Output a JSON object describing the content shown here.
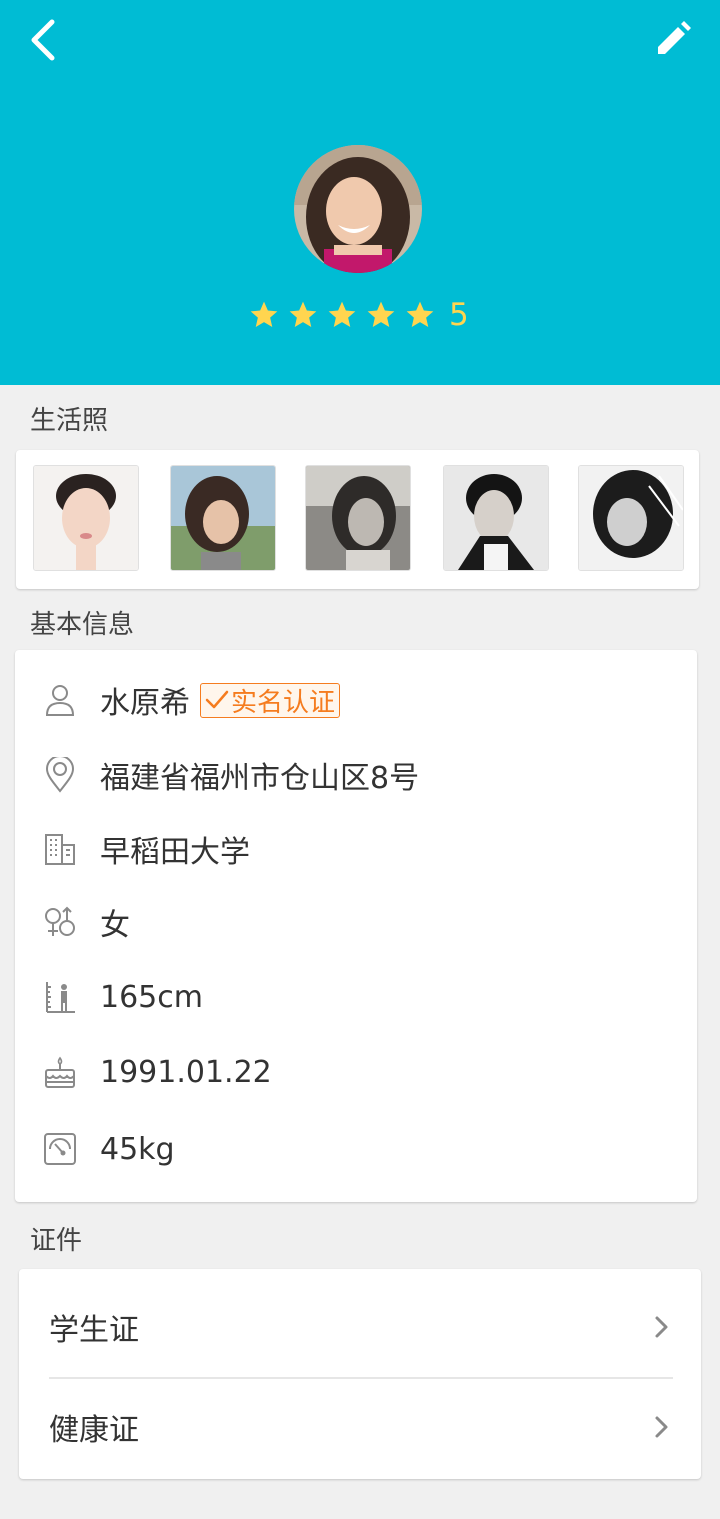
{
  "header": {
    "rating_value": "5",
    "rating_stars": 5,
    "accent_color": "#00bcd4",
    "star_color": "#ffd54f"
  },
  "sections": {
    "photos_title": "生活照",
    "basic_title": "基本信息",
    "certs_title": "证件"
  },
  "basic_info": {
    "name": "水原希",
    "verify_label": "实名认证",
    "address": "福建省福州市仓山区8号",
    "school": "早稻田大学",
    "gender": "女",
    "height": "165cm",
    "birthday": "1991.01.22",
    "weight": "45kg"
  },
  "certificates": [
    {
      "label": "学生证"
    },
    {
      "label": "健康证"
    }
  ],
  "icons": {
    "back": "back-arrow-icon",
    "edit": "pencil-icon",
    "person": "person-icon",
    "location": "location-pin-icon",
    "building": "building-icon",
    "gender": "gender-icon",
    "height": "height-ruler-icon",
    "birthday": "cake-icon",
    "weight": "scale-icon",
    "chevron": "chevron-right-icon"
  },
  "badge_color": "#f57c1f"
}
